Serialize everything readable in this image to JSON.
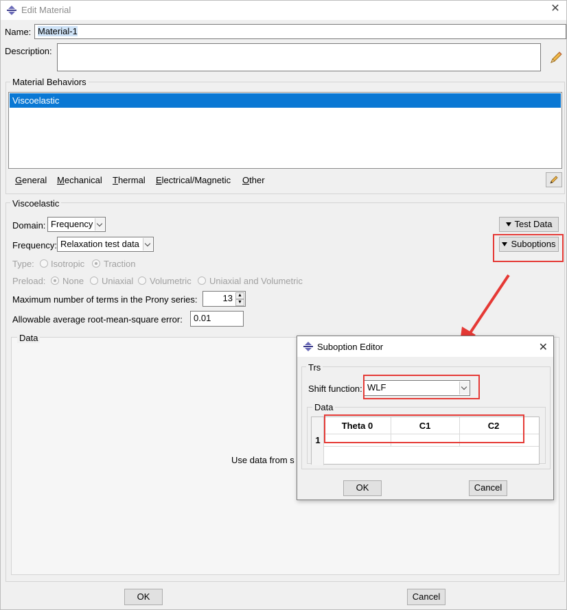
{
  "window": {
    "title": "Edit Material"
  },
  "name": {
    "label": "Name:",
    "value": "Material-1"
  },
  "description": {
    "label": "Description:",
    "value": ""
  },
  "behaviors": {
    "group_title": "Material Behaviors",
    "items": [
      "Viscoelastic"
    ],
    "selected": "Viscoelastic"
  },
  "menus": {
    "general": {
      "first": "G",
      "rest": "eneral"
    },
    "mechanical": {
      "first": "M",
      "rest": "echanical"
    },
    "thermal": {
      "first": "T",
      "rest": "hermal"
    },
    "electrical": {
      "first": "E",
      "rest": "lectrical/Magnetic"
    },
    "other": {
      "first": "O",
      "rest": "ther"
    }
  },
  "viscoelastic": {
    "group_title": "Viscoelastic",
    "domain_label": "Domain:",
    "domain_value": "Frequency",
    "frequency_label": "Frequency:",
    "frequency_value": "Relaxation test data",
    "test_data_button": "Test Data",
    "suboptions_button": "Suboptions",
    "type_label": "Type:",
    "type_isotropic": "Isotropic",
    "type_traction": "Traction",
    "preload_label": "Preload:",
    "preload_none": "None",
    "preload_uniaxial": "Uniaxial",
    "preload_volumetric": "Volumetric",
    "preload_uniaxial_volumetric": "Uniaxial and Volumetric",
    "prony_label": "Maximum number of terms in the Prony series:",
    "prony_value": "13",
    "rms_label": "Allowable average root-mean-square error:",
    "rms_value": "0.01",
    "data_title": "Data",
    "data_message": "Use data from s"
  },
  "footer": {
    "ok": "OK",
    "cancel": "Cancel"
  },
  "suboption_editor": {
    "title": "Suboption Editor",
    "group_title": "Trs",
    "shift_label": "Shift function:",
    "shift_value": "WLF",
    "data_title": "Data",
    "columns": [
      "Theta 0",
      "C1",
      "C2"
    ],
    "rows": [
      {
        "index": "1",
        "values": [
          "",
          "",
          ""
        ]
      }
    ],
    "ok": "OK",
    "cancel": "Cancel"
  },
  "colors": {
    "selection": "#0a78d4",
    "highlight": "#e53935"
  }
}
